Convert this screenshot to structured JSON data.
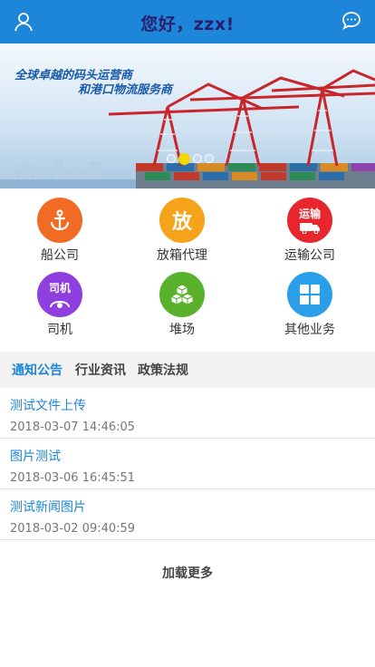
{
  "header": {
    "title": "您好，zzx!",
    "user_icon": "user-icon",
    "chat_icon": "chat-bubble-icon",
    "bg_color": "#1e86d8"
  },
  "banner": {
    "slogan_line1": "全球卓越的码头运营商",
    "slogan_line2": "和港口物流服务商",
    "slides": 4,
    "active_slide": 2
  },
  "services": [
    {
      "label": "船公司",
      "icon": "anchor-icon",
      "color": "#f26b25"
    },
    {
      "label": "放箱代理",
      "icon": "fang-char-icon",
      "icon_text": "放",
      "color": "#f6a31c"
    },
    {
      "label": "运输公司",
      "icon": "truck-icon",
      "icon_text": "运输",
      "color": "#e8262d"
    },
    {
      "label": "司机",
      "icon": "steering-wheel-icon",
      "icon_text": "司机",
      "color": "#8f3ee0"
    },
    {
      "label": "堆场",
      "icon": "stacked-boxes-icon",
      "color": "#5ab22c"
    },
    {
      "label": "其他业务",
      "icon": "grid-apps-icon",
      "color": "#2a9ee8"
    }
  ],
  "tabs": [
    {
      "label": "通知公告",
      "active": true
    },
    {
      "label": "行业资讯",
      "active": false
    },
    {
      "label": "政策法规",
      "active": false
    }
  ],
  "news": [
    {
      "title": "测试文件上传",
      "date": "2018-03-07 14:46:05"
    },
    {
      "title": "图片测试",
      "date": "2018-03-06 16:45:51"
    },
    {
      "title": "测试新闻图片",
      "date": "2018-03-02 09:40:59"
    }
  ],
  "load_more": "加载更多"
}
